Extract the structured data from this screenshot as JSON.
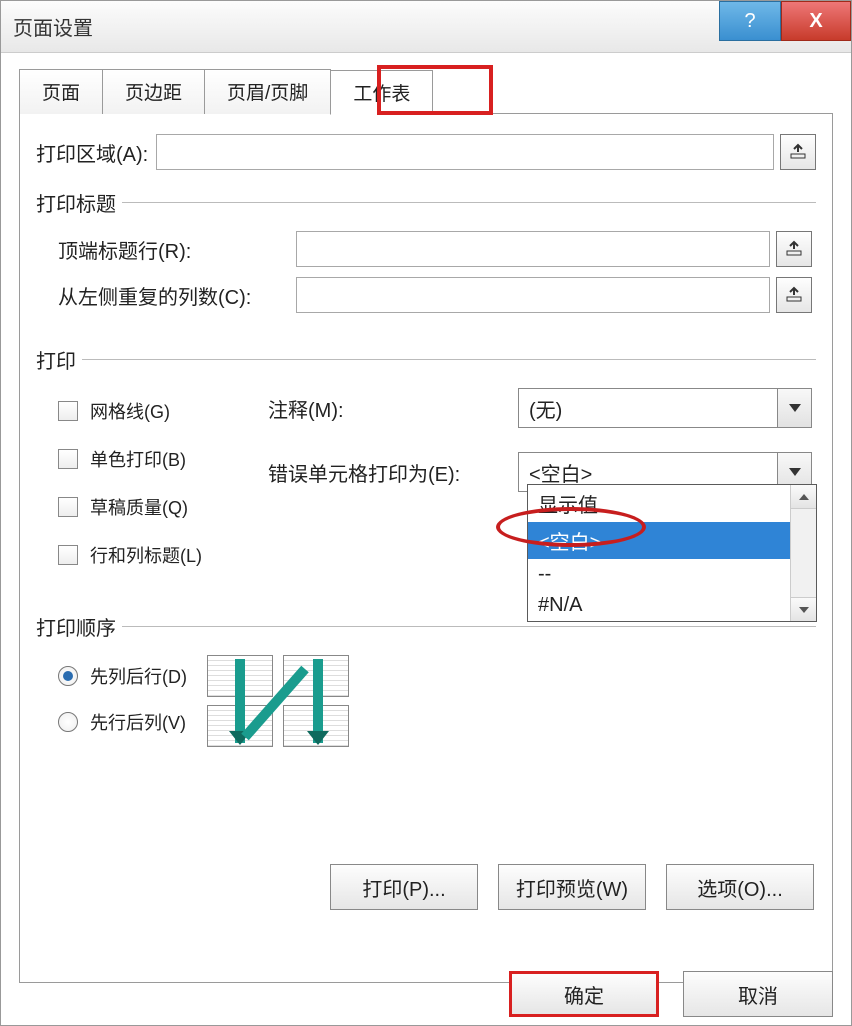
{
  "window": {
    "title": "页面设置",
    "help_glyph": "?",
    "close_glyph": "X"
  },
  "tabs": {
    "page": "页面",
    "margins": "页边距",
    "header_footer": "页眉/页脚",
    "sheet": "工作表"
  },
  "print_area_label": "打印区域(A):",
  "print_titles_legend": "打印标题",
  "top_rows_label": "顶端标题行(R):",
  "left_cols_label": "从左侧重复的列数(C):",
  "print_legend": "打印",
  "checkboxes": {
    "gridlines": "网格线(G)",
    "bw": "单色打印(B)",
    "draft": "草稿质量(Q)",
    "headings": "行和列标题(L)"
  },
  "comments_label": "注释(M):",
  "comments_value": "(无)",
  "errors_label": "错误单元格打印为(E):",
  "errors_value": "<空白>",
  "errors_options": {
    "displayed": "显示值",
    "blank": "<空白>",
    "dashes": "--",
    "na": "#N/A"
  },
  "order_legend": "打印顺序",
  "order_down_over": "先列后行(D)",
  "order_over_down": "先行后列(V)",
  "buttons": {
    "print": "打印(P)...",
    "preview": "打印预览(W)",
    "options": "选项(O)...",
    "ok": "确定",
    "cancel": "取消"
  }
}
